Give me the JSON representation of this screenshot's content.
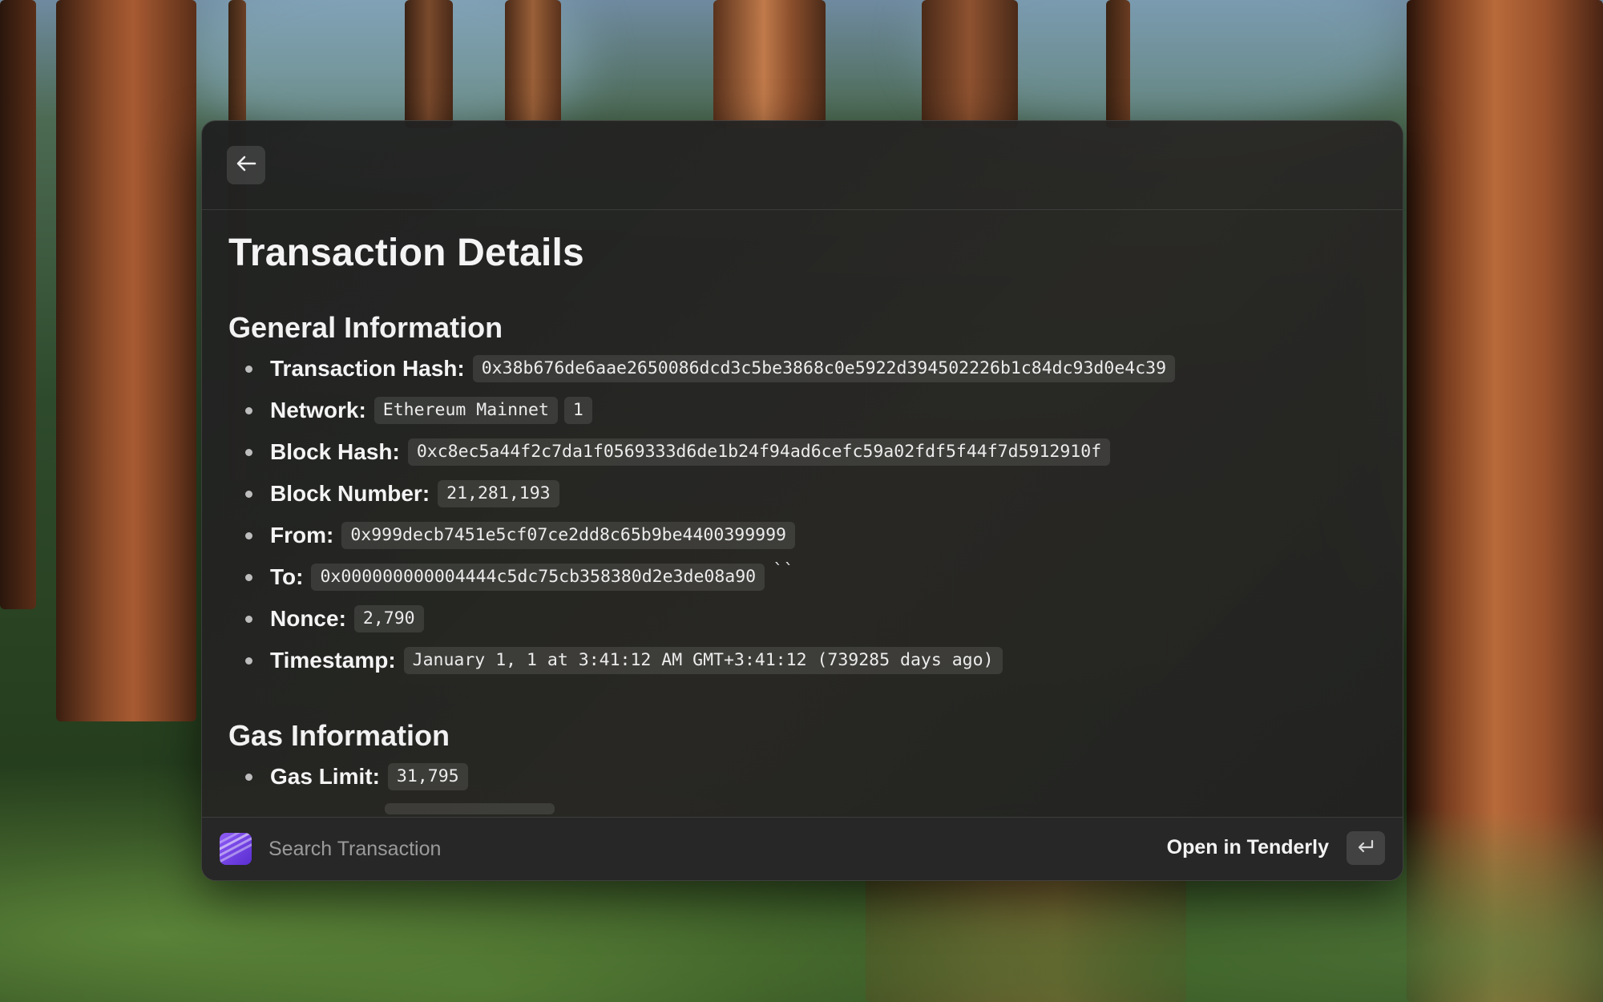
{
  "header": {
    "back_icon": "arrow-left-icon"
  },
  "details": {
    "title": "Transaction Details",
    "general": {
      "heading": "General Information",
      "fields": {
        "tx_hash": {
          "label": "Transaction Hash:",
          "value": "0x38b676de6aae2650086dcd3c5be3868c0e5922d394502226b1c84dc93d0e4c39"
        },
        "network": {
          "label": "Network:",
          "value": "Ethereum Mainnet",
          "chain_id": "1"
        },
        "block_hash": {
          "label": "Block Hash:",
          "value": "0xc8ec5a44f2c7da1f0569333d6de1b24f94ad6cefc59a02fdf5f44f7d5912910f"
        },
        "block_number": {
          "label": "Block Number:",
          "value": "21,281,193"
        },
        "from": {
          "label": "From:",
          "value": "0x999decb7451e5cf07ce2dd8c65b9be4400399999"
        },
        "to": {
          "label": "To:",
          "value": "0x000000000004444c5dc75cb358380d2e3de08a90",
          "trailing": "``"
        },
        "nonce": {
          "label": "Nonce:",
          "value": "2,790"
        },
        "timestamp": {
          "label": "Timestamp:",
          "value": "January 1, 1 at 3:41:12 AM GMT+3:41:12 (739285 days ago)"
        }
      }
    },
    "gas": {
      "heading": "Gas Information",
      "fields": {
        "gas_limit": {
          "label": "Gas Limit:",
          "value": "31,795"
        }
      }
    }
  },
  "footer": {
    "app_icon": "tenderly-app-icon",
    "search_placeholder": "Search Transaction",
    "search_value": "",
    "primary_action": "Open in Tenderly",
    "enter_icon": "return-key-icon"
  },
  "colors": {
    "window_bg": "#232323",
    "chip_bg": "rgba(255,255,255,0.10)",
    "accent_icon": "#7b48ea"
  }
}
